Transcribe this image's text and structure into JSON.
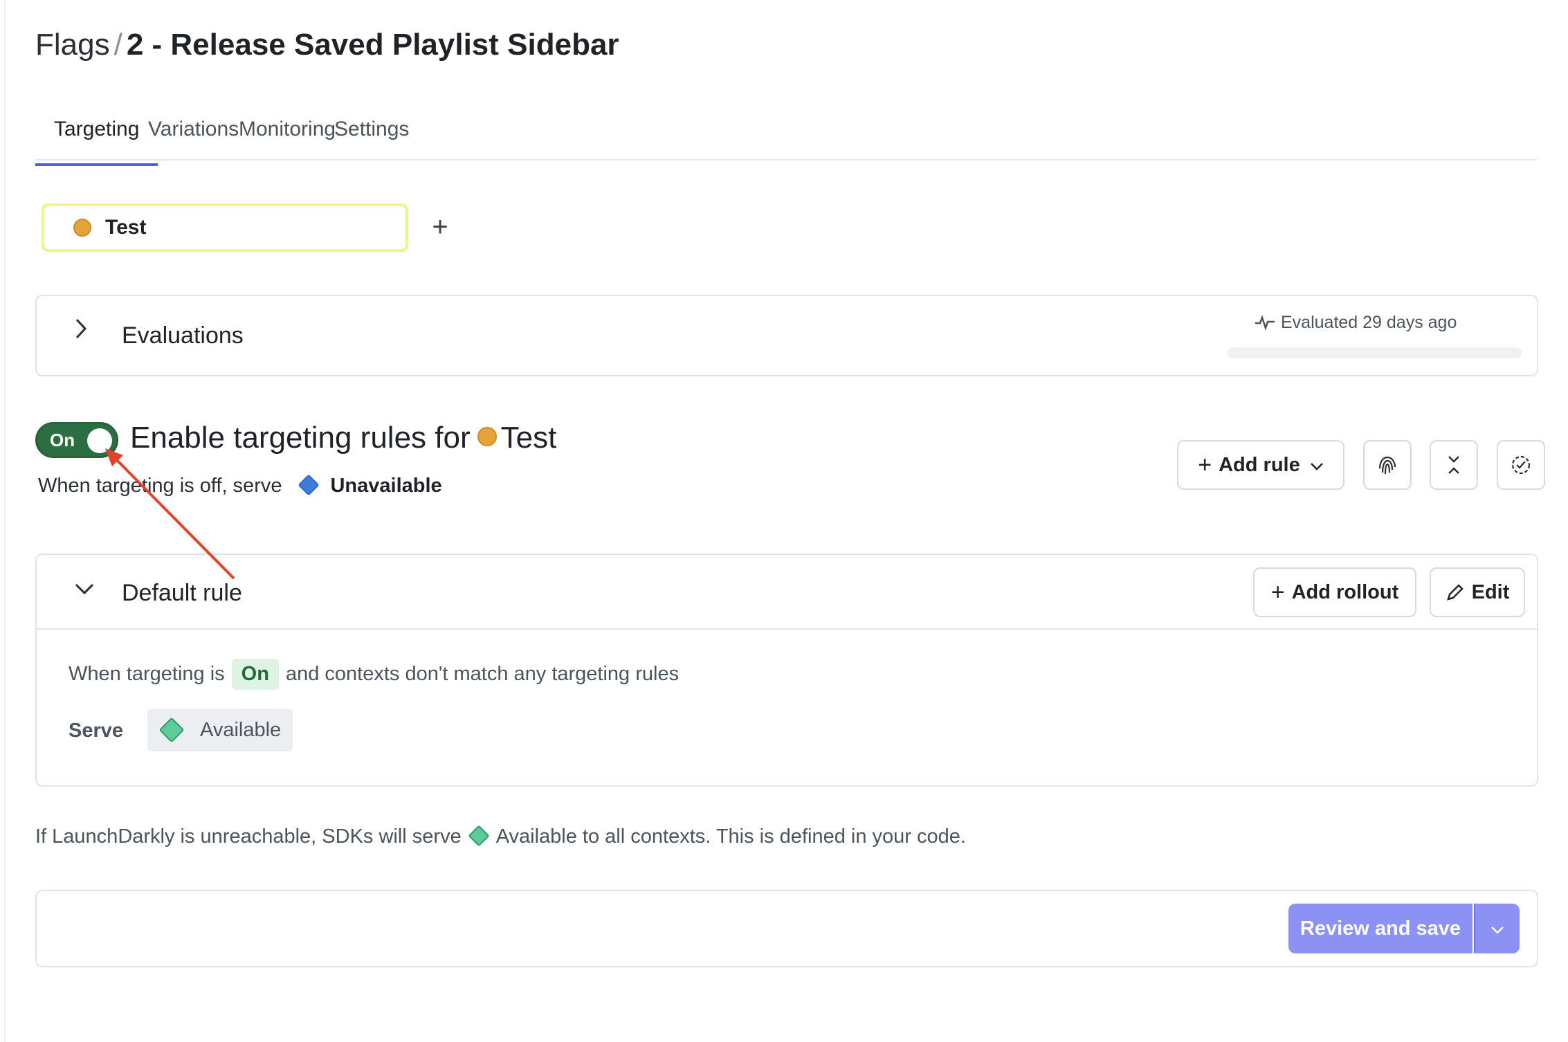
{
  "breadcrumb": {
    "root": "Flags",
    "separator": "/",
    "flag_name": "2 - Release Saved Playlist Sidebar"
  },
  "tabs": [
    {
      "label": "Targeting",
      "active": true
    },
    {
      "label": "Variations",
      "active": false
    },
    {
      "label": "Monitoring",
      "active": false
    },
    {
      "label": "Settings",
      "active": false
    }
  ],
  "environment": {
    "name": "Test",
    "color": "#e5a43b",
    "add_icon": "plus-icon"
  },
  "evaluations": {
    "title": "Evaluations",
    "meta": "Evaluated 29 days ago",
    "meta_icon": "activity-icon"
  },
  "targeting": {
    "toggle_label": "On",
    "title_prefix": "Enable targeting rules for",
    "env_name": "Test",
    "off_text": "When targeting is off, serve",
    "off_variation": "Unavailable",
    "off_variation_color": "#3b7ddd"
  },
  "actions": {
    "add_rule": "Add rule",
    "fingerprint_icon": "fingerprint-icon",
    "collapse_icon": "collapse-icon",
    "check_icon": "check-circle-icon"
  },
  "default_rule": {
    "title": "Default rule",
    "add_rollout": "Add rollout",
    "edit": "Edit",
    "when_prefix": "When targeting is",
    "state": "On",
    "when_suffix": "and contexts don't match any targeting rules",
    "serve_label": "Serve",
    "serve_variation": "Available",
    "serve_variation_color": "#5ccd9a"
  },
  "fallback": {
    "prefix": "If LaunchDarkly is unreachable, SDKs will serve",
    "suffix": "Available to all contexts. This is defined in your code."
  },
  "save": {
    "label": "Review and save"
  },
  "annotation": {
    "color": "#e0432b"
  }
}
